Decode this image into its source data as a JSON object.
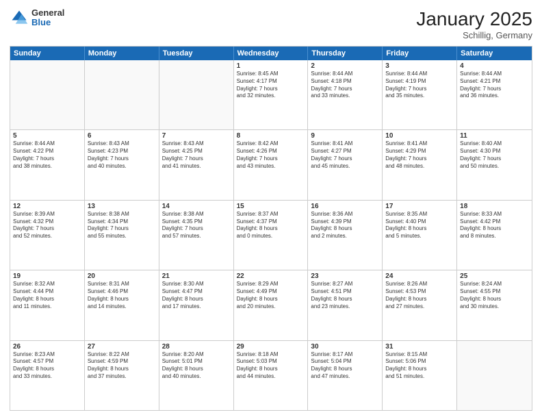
{
  "header": {
    "logo_general": "General",
    "logo_blue": "Blue",
    "month_title": "January 2025",
    "location": "Schillig, Germany"
  },
  "days_of_week": [
    "Sunday",
    "Monday",
    "Tuesday",
    "Wednesday",
    "Thursday",
    "Friday",
    "Saturday"
  ],
  "weeks": [
    [
      {
        "day": "",
        "text": "",
        "empty": true
      },
      {
        "day": "",
        "text": "",
        "empty": true
      },
      {
        "day": "",
        "text": "",
        "empty": true
      },
      {
        "day": "1",
        "text": "Sunrise: 8:45 AM\nSunset: 4:17 PM\nDaylight: 7 hours\nand 32 minutes.",
        "empty": false
      },
      {
        "day": "2",
        "text": "Sunrise: 8:44 AM\nSunset: 4:18 PM\nDaylight: 7 hours\nand 33 minutes.",
        "empty": false
      },
      {
        "day": "3",
        "text": "Sunrise: 8:44 AM\nSunset: 4:19 PM\nDaylight: 7 hours\nand 35 minutes.",
        "empty": false
      },
      {
        "day": "4",
        "text": "Sunrise: 8:44 AM\nSunset: 4:21 PM\nDaylight: 7 hours\nand 36 minutes.",
        "empty": false
      }
    ],
    [
      {
        "day": "5",
        "text": "Sunrise: 8:44 AM\nSunset: 4:22 PM\nDaylight: 7 hours\nand 38 minutes.",
        "empty": false
      },
      {
        "day": "6",
        "text": "Sunrise: 8:43 AM\nSunset: 4:23 PM\nDaylight: 7 hours\nand 40 minutes.",
        "empty": false
      },
      {
        "day": "7",
        "text": "Sunrise: 8:43 AM\nSunset: 4:25 PM\nDaylight: 7 hours\nand 41 minutes.",
        "empty": false
      },
      {
        "day": "8",
        "text": "Sunrise: 8:42 AM\nSunset: 4:26 PM\nDaylight: 7 hours\nand 43 minutes.",
        "empty": false
      },
      {
        "day": "9",
        "text": "Sunrise: 8:41 AM\nSunset: 4:27 PM\nDaylight: 7 hours\nand 45 minutes.",
        "empty": false
      },
      {
        "day": "10",
        "text": "Sunrise: 8:41 AM\nSunset: 4:29 PM\nDaylight: 7 hours\nand 48 minutes.",
        "empty": false
      },
      {
        "day": "11",
        "text": "Sunrise: 8:40 AM\nSunset: 4:30 PM\nDaylight: 7 hours\nand 50 minutes.",
        "empty": false
      }
    ],
    [
      {
        "day": "12",
        "text": "Sunrise: 8:39 AM\nSunset: 4:32 PM\nDaylight: 7 hours\nand 52 minutes.",
        "empty": false
      },
      {
        "day": "13",
        "text": "Sunrise: 8:38 AM\nSunset: 4:34 PM\nDaylight: 7 hours\nand 55 minutes.",
        "empty": false
      },
      {
        "day": "14",
        "text": "Sunrise: 8:38 AM\nSunset: 4:35 PM\nDaylight: 7 hours\nand 57 minutes.",
        "empty": false
      },
      {
        "day": "15",
        "text": "Sunrise: 8:37 AM\nSunset: 4:37 PM\nDaylight: 8 hours\nand 0 minutes.",
        "empty": false
      },
      {
        "day": "16",
        "text": "Sunrise: 8:36 AM\nSunset: 4:39 PM\nDaylight: 8 hours\nand 2 minutes.",
        "empty": false
      },
      {
        "day": "17",
        "text": "Sunrise: 8:35 AM\nSunset: 4:40 PM\nDaylight: 8 hours\nand 5 minutes.",
        "empty": false
      },
      {
        "day": "18",
        "text": "Sunrise: 8:33 AM\nSunset: 4:42 PM\nDaylight: 8 hours\nand 8 minutes.",
        "empty": false
      }
    ],
    [
      {
        "day": "19",
        "text": "Sunrise: 8:32 AM\nSunset: 4:44 PM\nDaylight: 8 hours\nand 11 minutes.",
        "empty": false
      },
      {
        "day": "20",
        "text": "Sunrise: 8:31 AM\nSunset: 4:46 PM\nDaylight: 8 hours\nand 14 minutes.",
        "empty": false
      },
      {
        "day": "21",
        "text": "Sunrise: 8:30 AM\nSunset: 4:47 PM\nDaylight: 8 hours\nand 17 minutes.",
        "empty": false
      },
      {
        "day": "22",
        "text": "Sunrise: 8:29 AM\nSunset: 4:49 PM\nDaylight: 8 hours\nand 20 minutes.",
        "empty": false
      },
      {
        "day": "23",
        "text": "Sunrise: 8:27 AM\nSunset: 4:51 PM\nDaylight: 8 hours\nand 23 minutes.",
        "empty": false
      },
      {
        "day": "24",
        "text": "Sunrise: 8:26 AM\nSunset: 4:53 PM\nDaylight: 8 hours\nand 27 minutes.",
        "empty": false
      },
      {
        "day": "25",
        "text": "Sunrise: 8:24 AM\nSunset: 4:55 PM\nDaylight: 8 hours\nand 30 minutes.",
        "empty": false
      }
    ],
    [
      {
        "day": "26",
        "text": "Sunrise: 8:23 AM\nSunset: 4:57 PM\nDaylight: 8 hours\nand 33 minutes.",
        "empty": false
      },
      {
        "day": "27",
        "text": "Sunrise: 8:22 AM\nSunset: 4:59 PM\nDaylight: 8 hours\nand 37 minutes.",
        "empty": false
      },
      {
        "day": "28",
        "text": "Sunrise: 8:20 AM\nSunset: 5:01 PM\nDaylight: 8 hours\nand 40 minutes.",
        "empty": false
      },
      {
        "day": "29",
        "text": "Sunrise: 8:18 AM\nSunset: 5:03 PM\nDaylight: 8 hours\nand 44 minutes.",
        "empty": false
      },
      {
        "day": "30",
        "text": "Sunrise: 8:17 AM\nSunset: 5:04 PM\nDaylight: 8 hours\nand 47 minutes.",
        "empty": false
      },
      {
        "day": "31",
        "text": "Sunrise: 8:15 AM\nSunset: 5:06 PM\nDaylight: 8 hours\nand 51 minutes.",
        "empty": false
      },
      {
        "day": "",
        "text": "",
        "empty": true
      }
    ]
  ]
}
